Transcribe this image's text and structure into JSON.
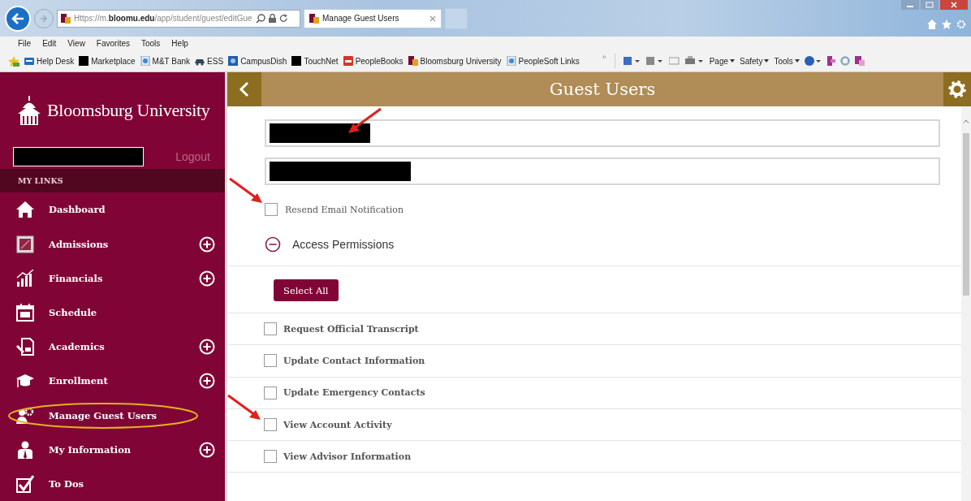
{
  "browser": {
    "url": "Https://m.**bloomu.edu**/app/student/guest/editGue",
    "tab_title": "Manage Guest Users",
    "menu": [
      "File",
      "Edit",
      "View",
      "Favorites",
      "Tools",
      "Help"
    ],
    "favorites": [
      {
        "label": "Help Desk",
        "kind": "desk"
      },
      {
        "label": "Marketplace",
        "kind": "black"
      },
      {
        "label": "M&T Bank",
        "kind": "page"
      },
      {
        "label": "ESS",
        "kind": "car"
      },
      {
        "label": "CampusDish",
        "kind": "blue"
      },
      {
        "label": "TouchNet",
        "kind": "black"
      },
      {
        "label": "PeopleBooks",
        "kind": "red"
      },
      {
        "label": "Bloomsburg University",
        "kind": "bu"
      },
      {
        "label": "PeopleSoft Links",
        "kind": "page"
      }
    ],
    "overflow": "»",
    "commands": [
      "Page",
      "Safety",
      "Tools"
    ]
  },
  "sidebar": {
    "brand": "Bloomsburg University",
    "user": {
      "kind": "redacted"
    },
    "logout": "Logout",
    "section": "MY LINKS",
    "items": [
      {
        "label": "Dashboard",
        "expandable": false,
        "circled": false
      },
      {
        "label": "Admissions",
        "expandable": true,
        "circled": false
      },
      {
        "label": "Financials",
        "expandable": true,
        "circled": false
      },
      {
        "label": "Schedule",
        "expandable": false,
        "circled": false
      },
      {
        "label": "Academics",
        "expandable": true,
        "circled": false
      },
      {
        "label": "Enrollment",
        "expandable": true,
        "circled": false
      },
      {
        "label": "Manage Guest Users",
        "expandable": false,
        "circled": true
      },
      {
        "label": "My Information",
        "expandable": true,
        "circled": false
      },
      {
        "label": "To Dos",
        "expandable": false,
        "circled": false
      }
    ]
  },
  "main": {
    "title": "Guest Users",
    "fields": [
      {
        "kind": "redacted",
        "arrow": true
      },
      {
        "kind": "redacted",
        "arrow": false
      }
    ],
    "resend": {
      "label": "Resend Email Notification",
      "checked": false,
      "arrow": true
    },
    "permissions": {
      "label": "Access Permissions",
      "expanded": true,
      "select_all": "Select All",
      "items": [
        {
          "label": "Request Official Transcript",
          "checked": false,
          "arrow": false
        },
        {
          "label": "Update Contact Information",
          "checked": false,
          "arrow": false
        },
        {
          "label": "Update Emergency Contacts",
          "checked": false,
          "arrow": false
        },
        {
          "label": "View Account Activity",
          "checked": false,
          "arrow": true
        },
        {
          "label": "View Advisor Information",
          "checked": false,
          "arrow": false
        }
      ]
    }
  }
}
